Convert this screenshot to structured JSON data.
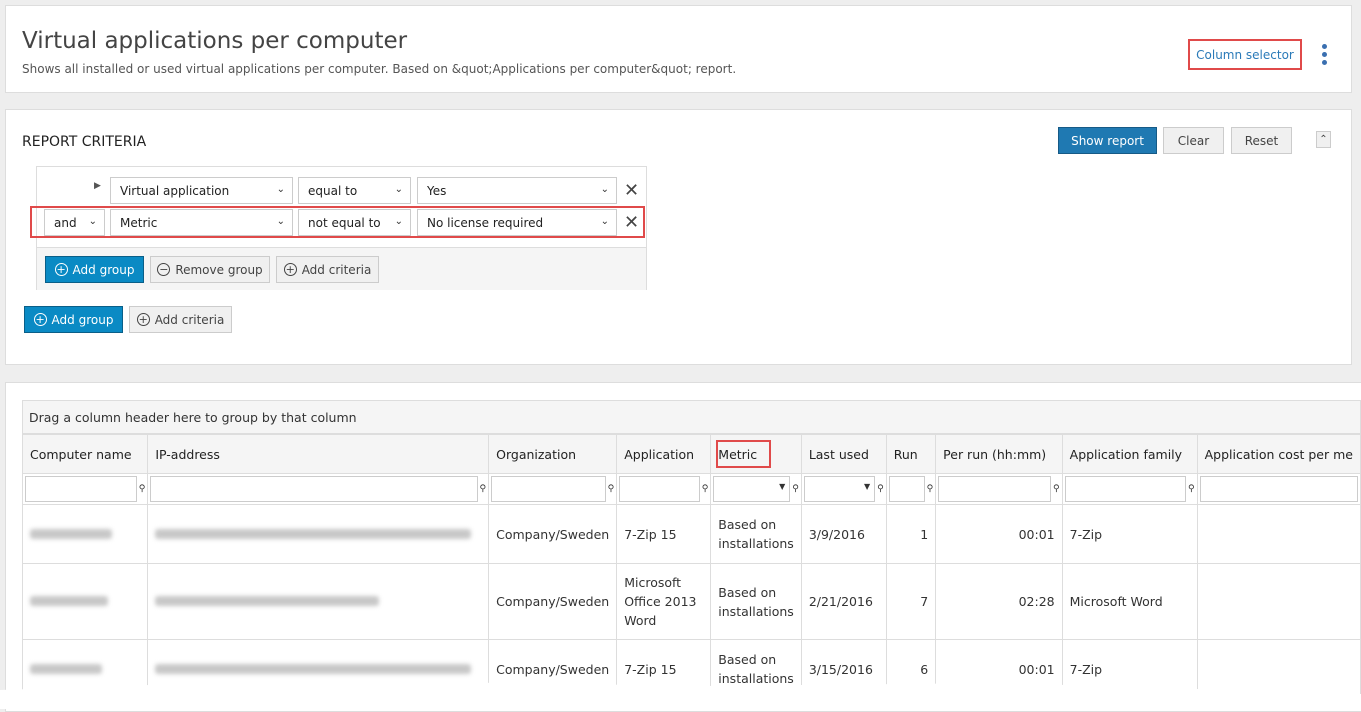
{
  "header": {
    "title": "Virtual applications per computer",
    "subtitle": "Shows all installed or used virtual applications per computer. Based on &quot;Applications per computer&quot; report.",
    "column_selector": "Column selector"
  },
  "criteria": {
    "title": "REPORT CRITERIA",
    "show_report": "Show report",
    "clear": "Clear",
    "reset": "Reset",
    "rows": [
      {
        "field": "Virtual application",
        "operator": "equal to",
        "value": "Yes"
      },
      {
        "conjunction": "and",
        "field": "Metric",
        "operator": "not equal to",
        "value": "No license required"
      }
    ],
    "add_group": "Add group",
    "remove_group": "Remove group",
    "add_criteria": "Add criteria"
  },
  "grid": {
    "drag_hint": "Drag a column header here to group by that column",
    "columns": [
      "Computer name",
      "IP-address",
      "Organization",
      "Application",
      "Metric",
      "Last used",
      "Run",
      "Per run (hh:mm)",
      "Application family",
      "Application cost per me"
    ],
    "rows": [
      {
        "organization": "Company/Sweden",
        "application": "7-Zip 15",
        "metric": "Based on installations",
        "last_used": "3/9/2016",
        "run": "1",
        "per_run": "00:01",
        "family": "7-Zip"
      },
      {
        "organization": "Company/Sweden",
        "application": "Microsoft Office 2013 Word",
        "metric": "Based on installations",
        "last_used": "2/21/2016",
        "run": "7",
        "per_run": "02:28",
        "family": "Microsoft Word"
      },
      {
        "organization": "Company/Sweden",
        "application": "7-Zip 15",
        "metric": "Based on installations",
        "last_used": "3/15/2016",
        "run": "6",
        "per_run": "00:01",
        "family": "7-Zip"
      }
    ]
  },
  "colors": {
    "accent": "#1f79b2",
    "highlight": "#e04a4a",
    "link": "#2a7ab8"
  }
}
